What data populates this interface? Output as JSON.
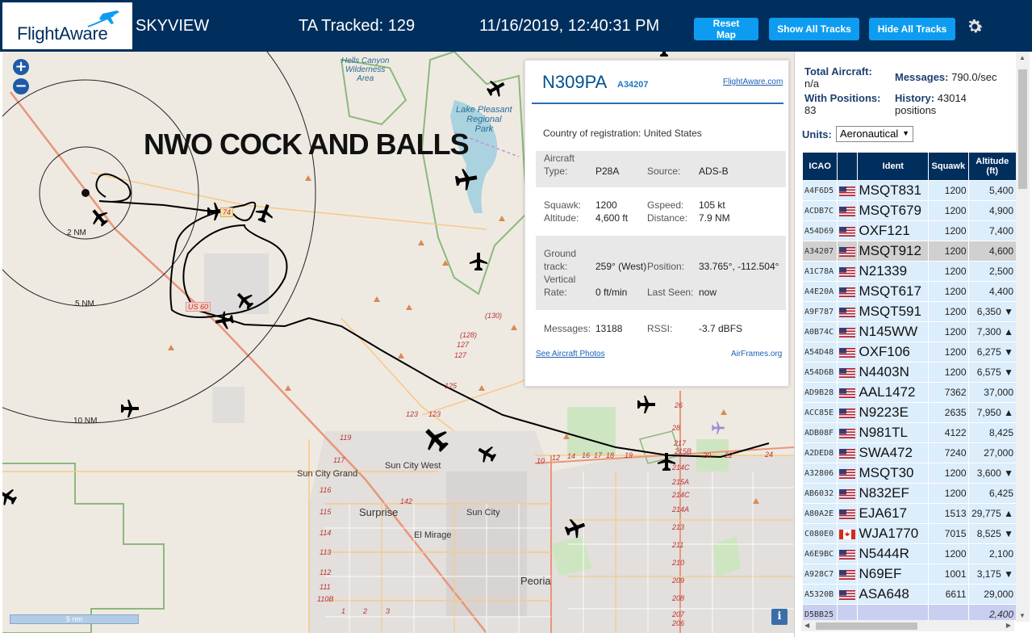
{
  "header": {
    "logo_text": "FlightAware",
    "app_name": "SKYVIEW",
    "ta_tracked": "TA Tracked: 129",
    "clock": "11/16/2019, 12:40:31 PM",
    "reset_map_label": "Reset Map",
    "show_all_tracks_label": "Show All Tracks",
    "hide_all_tracks_label": "Hide All Tracks",
    "brand_color": "#002f5d",
    "button_color": "#0e9cf0"
  },
  "map": {
    "overlay_text": "NWO COCK AND BALLS",
    "zoom_in": "+",
    "zoom_out": "−",
    "scale_label": "5 nm",
    "info_label": "i",
    "ring_labels": [
      "2 NM",
      "5 NM",
      "10 NM"
    ],
    "place_labels": {
      "hells_canyon": "Hells Canyon\nWilderness\nArea",
      "lake_pleasant": "Lake Pleasant\nRegional\nPark",
      "sun_city_grand": "Sun City Grand",
      "sun_city_west": "Sun City West",
      "surprise": "Surprise",
      "sun_city": "Sun City",
      "el_mirage": "El Mirage",
      "peoria": "Peoria",
      "us60": "US 60",
      "r74": "74"
    },
    "road_numbers": [
      "(130)",
      "(128)",
      "127",
      "127",
      "125",
      "123",
      "123",
      "119",
      "117",
      "116",
      "115",
      "114",
      "113",
      "112",
      "111",
      "110B",
      "10",
      "12",
      "14",
      "16",
      "17",
      "18",
      "19",
      "20",
      "22",
      "24",
      "26",
      "28",
      "217",
      "215B",
      "214C",
      "215A",
      "214C",
      "214A",
      "213",
      "211",
      "210",
      "209",
      "208",
      "207",
      "206",
      "205",
      "142",
      "1",
      "2",
      "3"
    ]
  },
  "popup": {
    "ident": "N309PA",
    "icao": "A34207",
    "fa_link": "FlightAware.com",
    "country_label": "Country of registration:",
    "country": "United States",
    "aircraft_type_label": "Aircraft Type:",
    "aircraft_type_label_1": "Aircraft",
    "aircraft_type_label_2": "Type:",
    "aircraft_type": "P28A",
    "source_label": "Source:",
    "source": "ADS-B",
    "squawk_label": "Squawk:",
    "squawk": "1200",
    "gspeed_label": "Gspeed:",
    "gspeed": "105 kt",
    "altitude_label": "Altitude:",
    "altitude": "4,600 ft",
    "distance_label": "Distance:",
    "distance": "7.9 NM",
    "ground_track_label_1": "Ground",
    "ground_track_label_2": "track:",
    "ground_track": "259° (West)",
    "position_label": "Position:",
    "position": "33.765°, -112.504°",
    "vert_rate_label_1": "Vertical",
    "vert_rate_label_2": "Rate:",
    "vert_rate": "0 ft/min",
    "last_seen_label": "Last Seen:",
    "last_seen": "now",
    "messages_label": "Messages:",
    "messages": "13188",
    "rssi_label": "RSSI:",
    "rssi": "-3.7 dBFS",
    "photos_link": "See Aircraft Photos",
    "airframes_link": "AirFrames.org"
  },
  "stats": {
    "total_aircraft_label": "Total Aircraft:",
    "total_aircraft": "n/a",
    "messages_label": "Messages:",
    "messages": "790.0/sec",
    "with_positions_label": "With Positions:",
    "with_positions": "83",
    "history_label": "History:",
    "history": "43014",
    "history_unit": "positions",
    "units_label": "Units:",
    "units_value": "Aeronautical"
  },
  "table": {
    "headers": [
      "ICAO",
      "",
      "Ident",
      "Squawk",
      "Altitude (ft)"
    ],
    "rows": [
      {
        "icao": "A4F6D5",
        "flag": "US",
        "ident": "MSQT831",
        "squawk": "1200",
        "alt": "5,400"
      },
      {
        "icao": "ACDB7C",
        "flag": "US",
        "ident": "MSQT679",
        "squawk": "1200",
        "alt": "4,900"
      },
      {
        "icao": "A54D69",
        "flag": "US",
        "ident": "OXF121",
        "squawk": "1200",
        "alt": "7,400"
      },
      {
        "icao": "A34207",
        "flag": "US",
        "ident": "MSQT912",
        "squawk": "1200",
        "alt": "4,600",
        "selected": true
      },
      {
        "icao": "A1C78A",
        "flag": "US",
        "ident": "N21339",
        "squawk": "1200",
        "alt": "2,500"
      },
      {
        "icao": "A4E20A",
        "flag": "US",
        "ident": "MSQT617",
        "squawk": "1200",
        "alt": "4,400"
      },
      {
        "icao": "A9F787",
        "flag": "US",
        "ident": "MSQT591",
        "squawk": "1200",
        "alt": "6,350 ▼"
      },
      {
        "icao": "A0B74C",
        "flag": "US",
        "ident": "N145WW",
        "squawk": "1200",
        "alt": "7,300 ▲"
      },
      {
        "icao": "A54D48",
        "flag": "US",
        "ident": "OXF106",
        "squawk": "1200",
        "alt": "6,275 ▼"
      },
      {
        "icao": "A54D6B",
        "flag": "US",
        "ident": "N4403N",
        "squawk": "1200",
        "alt": "6,575 ▼"
      },
      {
        "icao": "AD9B28",
        "flag": "US",
        "ident": "AAL1472",
        "squawk": "7362",
        "alt": "37,000"
      },
      {
        "icao": "ACC85E",
        "flag": "US",
        "ident": "N9223E",
        "squawk": "2635",
        "alt": "7,950 ▲"
      },
      {
        "icao": "ADB08F",
        "flag": "US",
        "ident": "N981TL",
        "squawk": "4122",
        "alt": "8,425"
      },
      {
        "icao": "A2DED8",
        "flag": "US",
        "ident": "SWA472",
        "squawk": "7240",
        "alt": "27,000"
      },
      {
        "icao": "A32806",
        "flag": "US",
        "ident": "MSQT30",
        "squawk": "1200",
        "alt": "3,600 ▼"
      },
      {
        "icao": "AB6032",
        "flag": "US",
        "ident": "N832EF",
        "squawk": "1200",
        "alt": "6,425"
      },
      {
        "icao": "A80A2E",
        "flag": "US",
        "ident": "EJA617",
        "squawk": "1513",
        "alt": "29,775 ▲"
      },
      {
        "icao": "C080E0",
        "flag": "CA",
        "ident": "WJA1770",
        "squawk": "7015",
        "alt": "8,525 ▼"
      },
      {
        "icao": "A6E9BC",
        "flag": "US",
        "ident": "N5444R",
        "squawk": "1200",
        "alt": "2,100"
      },
      {
        "icao": "A928C7",
        "flag": "US",
        "ident": "N69EF",
        "squawk": "1001",
        "alt": "3,175 ▼"
      },
      {
        "icao": "A5320B",
        "flag": "US",
        "ident": "ASA648",
        "squawk": "6611",
        "alt": "29,000"
      },
      {
        "icao": "D5BB25",
        "flag": "",
        "ident": "",
        "squawk": "",
        "alt": "2,400",
        "blank": true
      }
    ]
  }
}
